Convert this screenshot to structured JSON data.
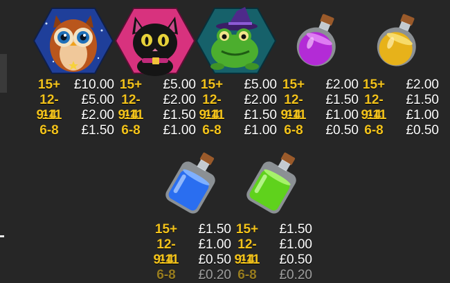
{
  "paytable": {
    "symbols": [
      {
        "name": "owl",
        "pays": [
          {
            "count": "15+",
            "amount": "£10.00"
          },
          {
            "count": "12-14",
            "amount": "£5.00"
          },
          {
            "count": "9-11",
            "amount": "£2.00"
          },
          {
            "count": "6-8",
            "amount": "£1.50"
          }
        ]
      },
      {
        "name": "black-cat",
        "pays": [
          {
            "count": "15+",
            "amount": "£5.00"
          },
          {
            "count": "12-14",
            "amount": "£2.00"
          },
          {
            "count": "9-11",
            "amount": "£1.50"
          },
          {
            "count": "6-8",
            "amount": "£1.00"
          }
        ]
      },
      {
        "name": "witch-frog",
        "pays": [
          {
            "count": "15+",
            "amount": "£5.00"
          },
          {
            "count": "12-14",
            "amount": "£2.00"
          },
          {
            "count": "9-11",
            "amount": "£1.50"
          },
          {
            "count": "6-8",
            "amount": "£1.00"
          }
        ]
      },
      {
        "name": "purple-potion",
        "pays": [
          {
            "count": "15+",
            "amount": "£2.00"
          },
          {
            "count": "12-14",
            "amount": "£1.50"
          },
          {
            "count": "9-11",
            "amount": "£1.00"
          },
          {
            "count": "6-8",
            "amount": "£0.50"
          }
        ]
      },
      {
        "name": "gold-potion",
        "pays": [
          {
            "count": "15+",
            "amount": "£2.00"
          },
          {
            "count": "12-14",
            "amount": "£1.50"
          },
          {
            "count": "9-11",
            "amount": "£1.00"
          },
          {
            "count": "6-8",
            "amount": "£0.50"
          }
        ]
      },
      {
        "name": "blue-potion",
        "pays": [
          {
            "count": "15+",
            "amount": "£1.50"
          },
          {
            "count": "12-14",
            "amount": "£1.00"
          },
          {
            "count": "9-11",
            "amount": "£0.50"
          },
          {
            "count": "6-8",
            "amount": "£0.20"
          }
        ]
      },
      {
        "name": "green-potion",
        "pays": [
          {
            "count": "15+",
            "amount": "£1.50"
          },
          {
            "count": "12-14",
            "amount": "£1.00"
          },
          {
            "count": "9-11",
            "amount": "£0.50"
          },
          {
            "count": "6-8",
            "amount": "£0.20"
          }
        ]
      }
    ]
  },
  "colors": {
    "background": "#262626",
    "count": "#f2c21b",
    "amount": "#ffffff",
    "purple": "#b32bd6",
    "gold": "#e7b21a",
    "blue": "#2a6ef0",
    "green": "#5fd21c"
  }
}
